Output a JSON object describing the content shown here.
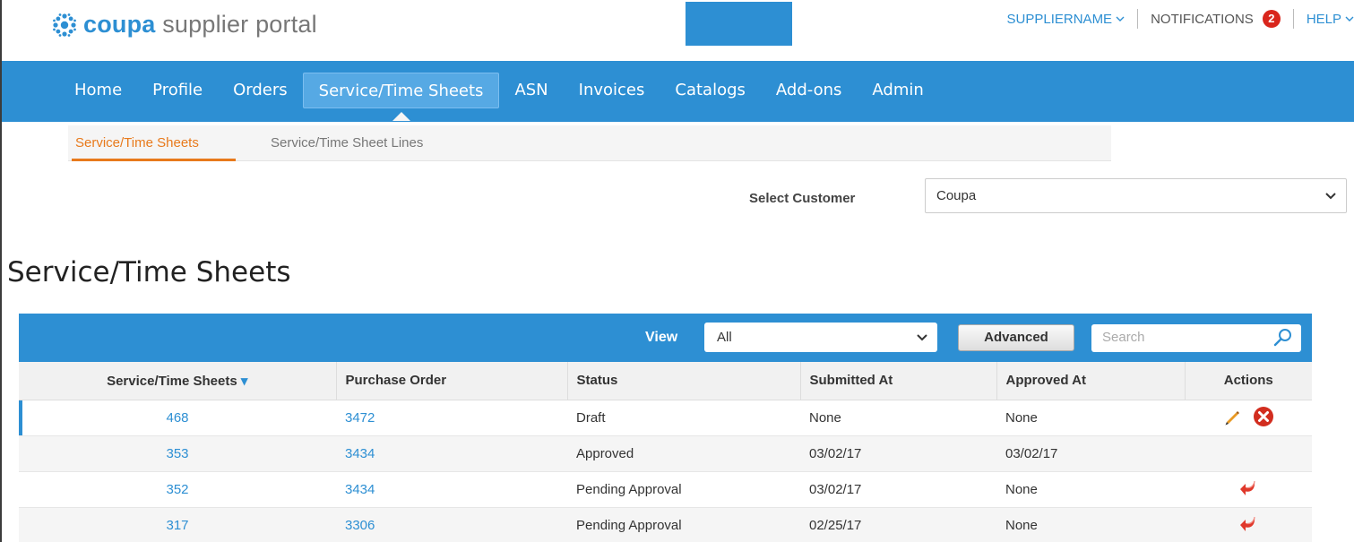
{
  "logo": {
    "brand": "coupa",
    "suffix": " supplier portal"
  },
  "header": {
    "user": "SUPPLIERNAME",
    "notifications_label": "NOTIFICATIONS",
    "notifications_count": "2",
    "help": "HELP"
  },
  "nav": {
    "tabs": [
      {
        "label": "Home"
      },
      {
        "label": "Profile"
      },
      {
        "label": "Orders"
      },
      {
        "label": "Service/Time Sheets",
        "active": true
      },
      {
        "label": "ASN"
      },
      {
        "label": "Invoices"
      },
      {
        "label": "Catalogs"
      },
      {
        "label": "Add-ons"
      },
      {
        "label": "Admin"
      }
    ]
  },
  "subnav": {
    "items": [
      {
        "label": "Service/Time Sheets",
        "active": true
      },
      {
        "label": "Service/Time Sheet Lines"
      }
    ]
  },
  "customer": {
    "label": "Select Customer",
    "value": "Coupa"
  },
  "page": {
    "title": "Service/Time Sheets"
  },
  "table_toolbar": {
    "view_label": "View",
    "view_value": "All",
    "advanced_label": "Advanced",
    "search_placeholder": "Search"
  },
  "table": {
    "headers": [
      "Service/Time Sheets",
      "Purchase Order",
      "Status",
      "Submitted At",
      "Approved At",
      "Actions"
    ],
    "sort_indicator": "▾",
    "rows": [
      {
        "id": "468",
        "po": "3472",
        "status": "Draft",
        "submitted": "None",
        "approved": "None",
        "actions": [
          "edit-icon",
          "delete-icon"
        ]
      },
      {
        "id": "353",
        "po": "3434",
        "status": "Approved",
        "submitted": "03/02/17",
        "approved": "03/02/17",
        "actions": []
      },
      {
        "id": "352",
        "po": "3434",
        "status": "Pending Approval",
        "submitted": "03/02/17",
        "approved": "None",
        "actions": [
          "withdraw-icon"
        ]
      },
      {
        "id": "317",
        "po": "3306",
        "status": "Pending Approval",
        "submitted": "02/25/17",
        "approved": "None",
        "actions": [
          "withdraw-icon"
        ]
      }
    ]
  },
  "colors": {
    "brand_blue": "#2d8fd3",
    "accent_orange": "#e87a1c",
    "badge_red": "#d9261c"
  }
}
